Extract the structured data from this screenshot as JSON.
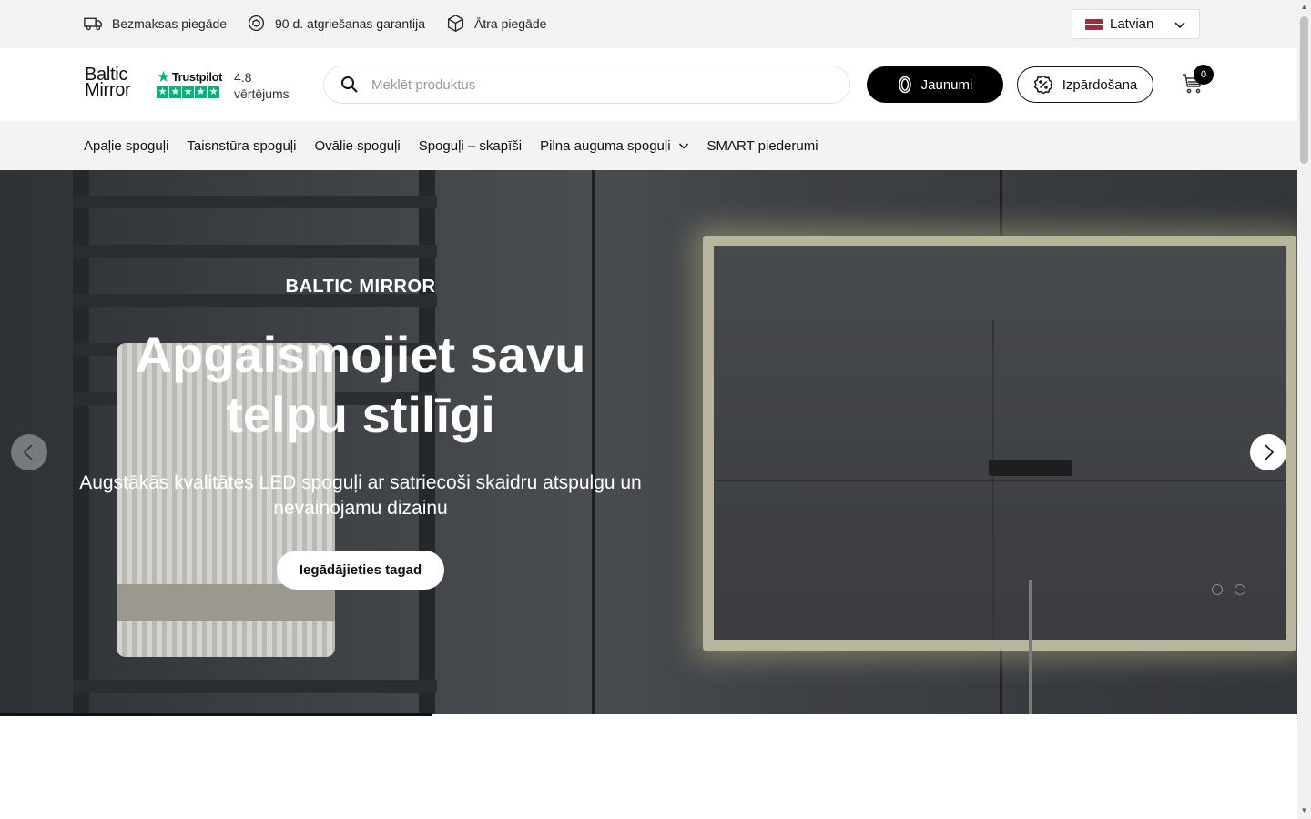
{
  "topbar": {
    "perks": [
      {
        "label": "Bezmaksas piegāde",
        "icon": "truck-icon"
      },
      {
        "label": "90 d. atgriešanas garantija",
        "icon": "return-guarantee-icon"
      },
      {
        "label": "Ātra piegāde",
        "icon": "box-icon"
      }
    ],
    "language": "Latvian"
  },
  "header": {
    "logo_line1": "Baltic",
    "logo_line2": "Mirror",
    "trustpilot": "Trustpilot",
    "rating_value": "4.8",
    "rating_label": "vērtējums",
    "search_placeholder": "Meklēt produktus",
    "new_button": "Jaunumi",
    "sale_button": "Izpārdošana",
    "cart_count": "0"
  },
  "nav": {
    "items": [
      "Apaļie spoguļi",
      "Taisnstūra spoguļi",
      "Ovālie spoguļi",
      "Spoguļi – skapīši",
      "Pilna auguma spoguļi",
      "SMART piederumi"
    ]
  },
  "hero": {
    "eyebrow": "BALTIC MIRROR",
    "headline_line1": "Apgaismojiet savu",
    "headline_line2": "telpu stilīgi",
    "subtext": "Augstākās kvalitātes LED spoguļi ar satriecoši skaidru atspulgu un nevainojamu dizainu",
    "cta": "Iegādājieties tagad"
  },
  "colors": {
    "accent": "#000000",
    "trustpilot_green": "#00b67a",
    "topbar_bg": "#f3f3f3"
  }
}
